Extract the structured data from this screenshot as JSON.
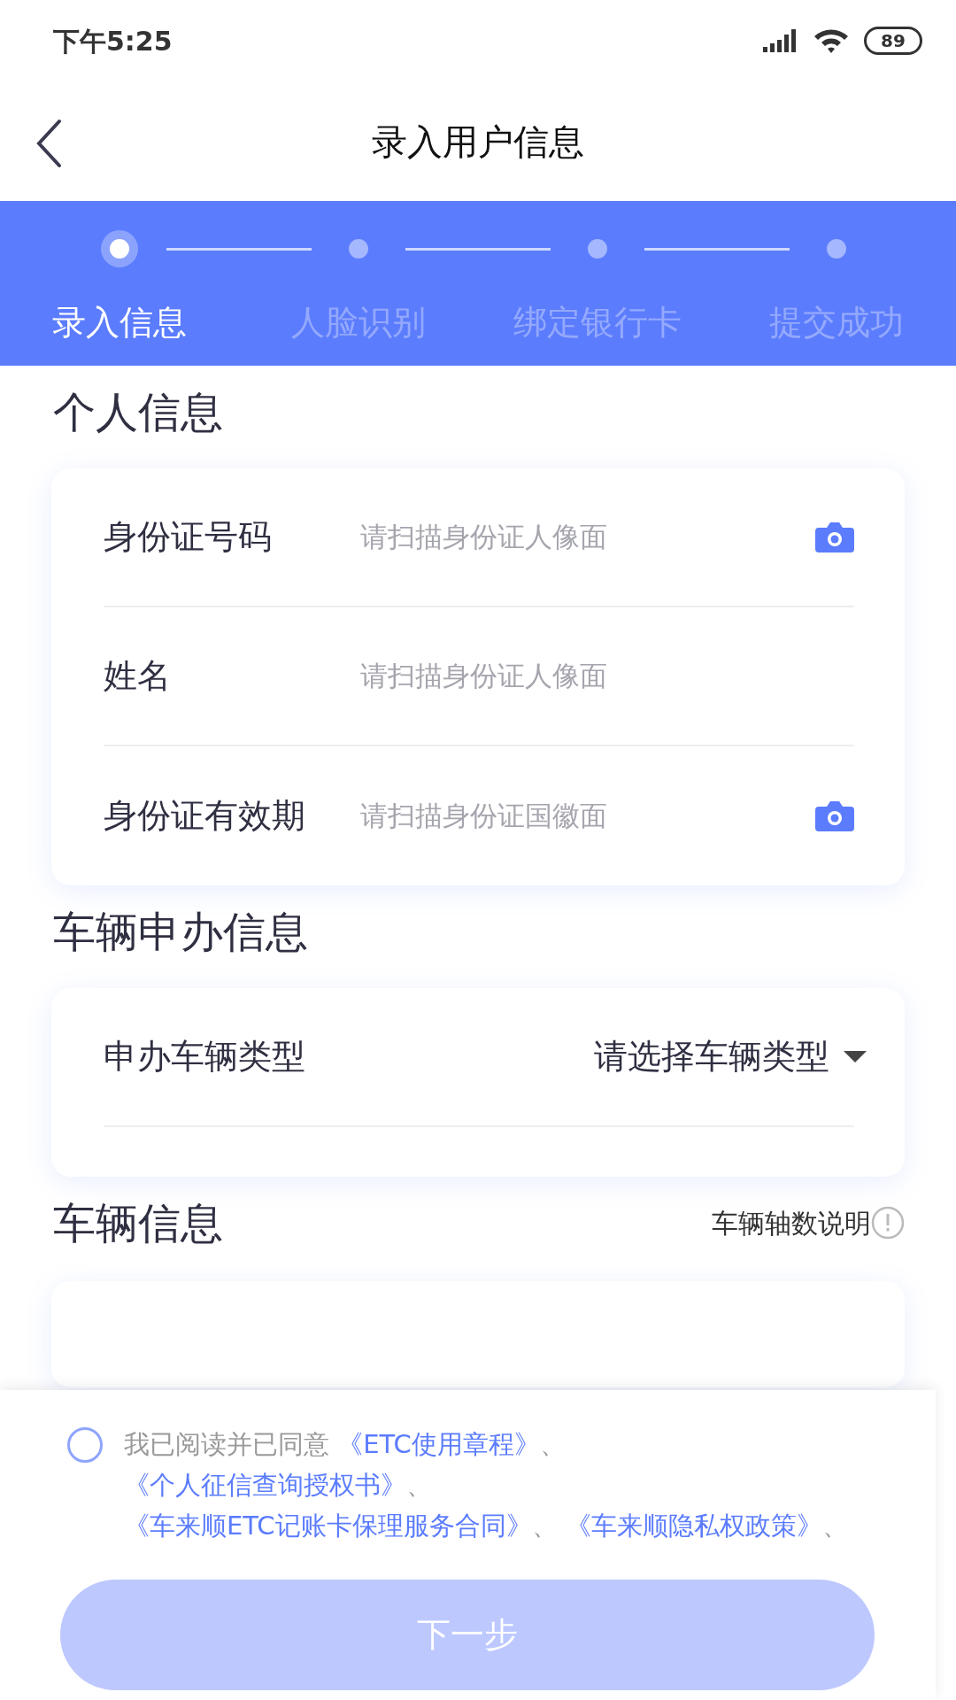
{
  "status_bar": {
    "time": "下午5:25",
    "battery": "89"
  },
  "nav": {
    "title": "录入用户信息"
  },
  "steps": [
    {
      "label": "录入信息",
      "selected": true
    },
    {
      "label": "人脸识别",
      "selected": false
    },
    {
      "label": "绑定银行卡",
      "selected": false
    },
    {
      "label": "提交成功",
      "selected": false
    }
  ],
  "sections": [
    {
      "title": "个人信息",
      "rows": [
        {
          "kind": "input",
          "label": "身份证号码",
          "placeholder": "请扫描身份证人像面",
          "scan": true
        },
        {
          "kind": "input",
          "label": "姓名",
          "placeholder": "请扫描身份证人像面",
          "scan": false
        },
        {
          "kind": "input",
          "label": "身份证有效期",
          "placeholder": "请扫描身份证国徽面",
          "scan": true
        }
      ]
    },
    {
      "title": "车辆申办信息",
      "rows": [
        {
          "kind": "select",
          "label": "申办车辆类型",
          "value": "请选择车辆类型"
        }
      ]
    },
    {
      "title": "车辆信息",
      "help": "车辆轴数说明"
    }
  ],
  "agreement": {
    "checked": false,
    "prefix": "我已阅读并已同意",
    "items": [
      {
        "link": "《ETC使用章程》",
        "sep": "、"
      },
      {
        "link": "《个人征信查询授权书》",
        "sep": "、"
      },
      {
        "link": "《车来顺ETC记账卡保理服务合同》",
        "sep": "、"
      },
      {
        "link": "《车来顺隐私权政策》",
        "sep": "、"
      }
    ]
  },
  "next_button": {
    "label": "下一步",
    "disabled": true
  }
}
